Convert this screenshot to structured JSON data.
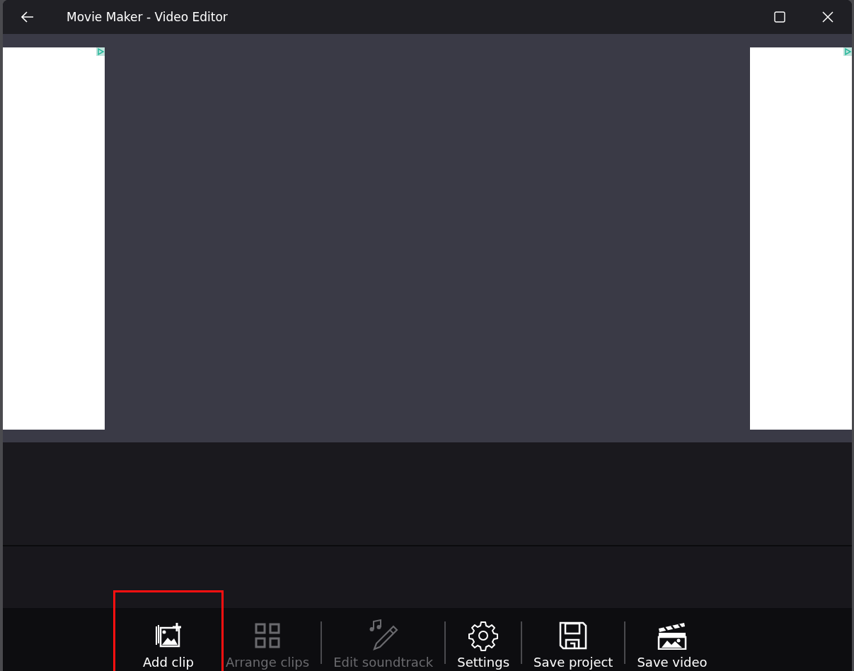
{
  "window": {
    "title": "Movie Maker - Video Editor"
  },
  "toolbar": [
    {
      "kind": "add-clip",
      "label": "Add clip",
      "disabled": false,
      "highlighted": true,
      "separator_before": false
    },
    {
      "kind": "arrange",
      "label": "Arrange clips",
      "disabled": true,
      "highlighted": false,
      "separator_before": false
    },
    {
      "kind": "soundtrack",
      "label": "Edit soundtrack",
      "disabled": true,
      "highlighted": false,
      "separator_before": true
    },
    {
      "kind": "settings",
      "label": "Settings",
      "disabled": false,
      "highlighted": false,
      "separator_before": true
    },
    {
      "kind": "save-project",
      "label": "Save project",
      "disabled": false,
      "highlighted": false,
      "separator_before": true
    },
    {
      "kind": "save-video",
      "label": "Save video",
      "disabled": false,
      "highlighted": false,
      "separator_before": true
    }
  ]
}
